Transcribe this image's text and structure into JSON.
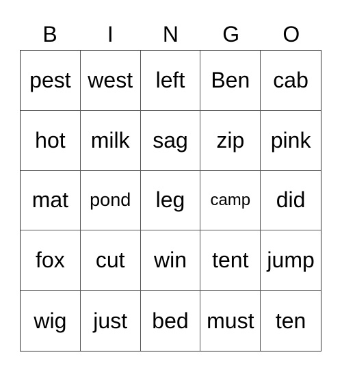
{
  "header": [
    "B",
    "I",
    "N",
    "G",
    "O"
  ],
  "cells": [
    [
      "pest",
      "west",
      "left",
      "Ben",
      "cab"
    ],
    [
      "hot",
      "milk",
      "sag",
      "zip",
      "pink"
    ],
    [
      "mat",
      "pond",
      "leg",
      "camp",
      "did"
    ],
    [
      "fox",
      "cut",
      "win",
      "tent",
      "jump"
    ],
    [
      "wig",
      "just",
      "bed",
      "must",
      "ten"
    ]
  ]
}
